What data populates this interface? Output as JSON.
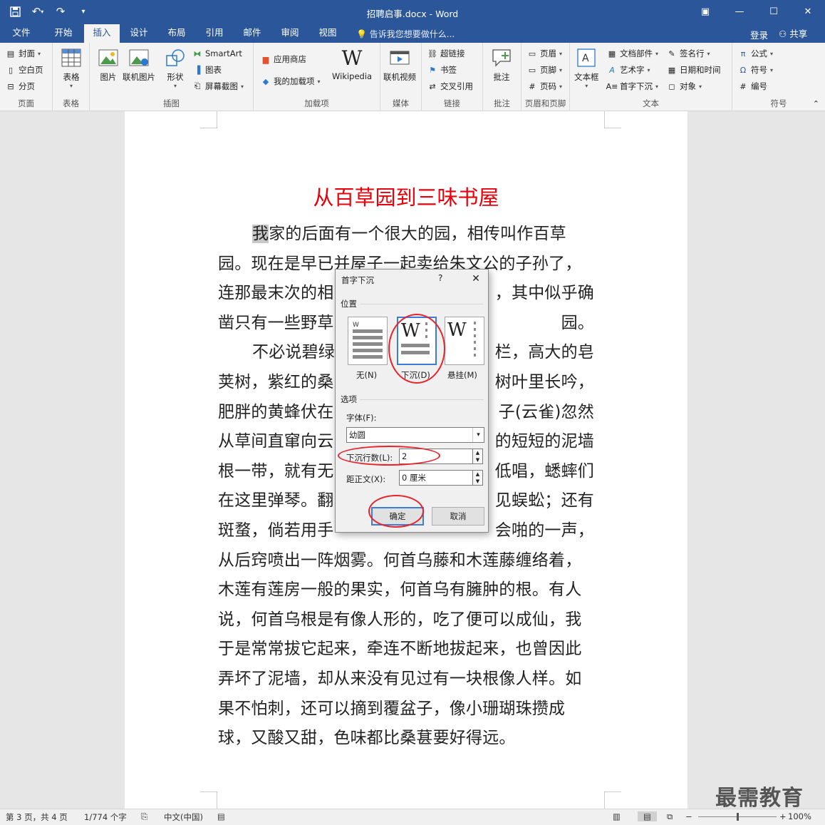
{
  "window": {
    "title": "招聘启事.docx - Word",
    "qat": [
      "save-icon",
      "undo-icon",
      "redo-icon",
      "customize-icon"
    ]
  },
  "tabs": [
    {
      "label": "文件"
    },
    {
      "label": "开始"
    },
    {
      "label": "插入"
    },
    {
      "label": "设计"
    },
    {
      "label": "布局"
    },
    {
      "label": "引用"
    },
    {
      "label": "邮件"
    },
    {
      "label": "审阅"
    },
    {
      "label": "视图"
    }
  ],
  "active_tab": "插入",
  "tell_me": "告诉我您想要做什么...",
  "account": {
    "login": "登录",
    "share": "共享"
  },
  "ribbon": {
    "groups": [
      "页面",
      "表格",
      "插图",
      "加载项",
      "媒体",
      "链接",
      "批注",
      "页眉和页脚",
      "文本",
      "符号"
    ],
    "page": {
      "cover": "封面",
      "blank": "空白页",
      "break": "分页"
    },
    "table": {
      "table": "表格"
    },
    "illustrations": {
      "picture": "图片",
      "online_picture": "联机图片",
      "shapes": "形状",
      "smartart": "SmartArt",
      "chart": "图表",
      "screenshot": "屏幕截图"
    },
    "addins": {
      "store": "应用商店",
      "my_addins": "我的加载项",
      "wikipedia": "Wikipedia"
    },
    "media": {
      "online_video": "联机视频"
    },
    "links": {
      "hyperlink": "超链接",
      "bookmark": "书签",
      "crossref": "交叉引用"
    },
    "comments": {
      "comment": "批注"
    },
    "header_footer": {
      "header": "页眉",
      "footer": "页脚",
      "page_number": "页码"
    },
    "text": {
      "textbox": "文本框",
      "quick_parts": "文档部件",
      "wordart": "艺术字",
      "dropcap": "首字下沉",
      "signature": "签名行",
      "datetime": "日期和时间",
      "object": "对象"
    },
    "symbols": {
      "equation": "公式",
      "symbol": "符号",
      "number": "编号"
    }
  },
  "document": {
    "title": "从百草园到三味书屋",
    "lines": [
      {
        "pre": "",
        "hl": "我",
        "text": "家的后面有一个很大的园，相传叫作百草"
      },
      {
        "pre": "",
        "hl": "",
        "text": "园。现在是早已并屋子一起卖给朱文公的子孙了，"
      },
      {
        "pre": "",
        "hl": "",
        "text": "连那最末次的相"
      },
      {
        "pre": "",
        "hl": "",
        "text": "凿只有一些野草"
      },
      {
        "pre": "",
        "hl": "",
        "text": "不必说碧绿"
      },
      {
        "pre": "",
        "hl": "",
        "text": "荚树，紫红的桑"
      },
      {
        "pre": "",
        "hl": "",
        "text": "肥胖的黄蜂伏在"
      },
      {
        "pre": "",
        "hl": "",
        "text": "从草间直窜向云"
      },
      {
        "pre": "",
        "hl": "",
        "text": "根一带，就有无"
      },
      {
        "pre": "",
        "hl": "",
        "text": "在这里弹琴。翻"
      },
      {
        "pre": "",
        "hl": "",
        "text": "斑蝥，倘若用手"
      },
      {
        "pre": "",
        "hl": "",
        "text": "从后窍喷出一阵烟雾。何首乌藤和木莲藤缠络着，"
      },
      {
        "pre": "",
        "hl": "",
        "text": "木莲有莲房一般的果实，何首乌有臃肿的根。有人"
      },
      {
        "pre": "",
        "hl": "",
        "text": "说，何首乌根是有像人形的，吃了便可以成仙，我"
      },
      {
        "pre": "",
        "hl": "",
        "text": "于是常常拔它起来，牵连不断地拔起来，也曾因此"
      },
      {
        "pre": "",
        "hl": "",
        "text": "弄坏了泥墙，却从来没有见过有一块根像人样。如"
      },
      {
        "pre": "",
        "hl": "",
        "text": "果不怕刺，还可以摘到覆盆子，像小珊瑚珠攒成"
      },
      {
        "pre": "",
        "hl": "",
        "text": "球，又酸又甜，色味都比桑葚要好得远。"
      }
    ],
    "right_fragments": [
      {
        "line": 2,
        "text": "，其中似乎确"
      },
      {
        "line": 3,
        "text": "园。"
      },
      {
        "line": 4,
        "text": "栏，高大的皂"
      },
      {
        "line": 5,
        "text": "树叶里长吟，"
      },
      {
        "line": 6,
        "text": "子(云雀)忽然"
      },
      {
        "line": 7,
        "text": "的短短的泥墙"
      },
      {
        "line": 8,
        "text": "低唱，蟋蟀们"
      },
      {
        "line": 9,
        "text": "见蜈蚣；还有"
      },
      {
        "line": 10,
        "text": "会啪的一声，"
      }
    ]
  },
  "dialog": {
    "title": "首字下沉",
    "help": "?",
    "position_label": "位置",
    "options": [
      {
        "label": "无(N)",
        "selected": false
      },
      {
        "label": "下沉(D)",
        "selected": true
      },
      {
        "label": "悬挂(M)",
        "selected": false
      }
    ],
    "options_label": "选项",
    "font_label": "字体(F):",
    "font_value": "幼圆",
    "lines_label": "下沉行数(L):",
    "lines_value": "2",
    "distance_label": "距正文(X):",
    "distance_value": "0 厘米",
    "ok": "确定",
    "cancel": "取消"
  },
  "status": {
    "page": "第 3 页，共 4 页",
    "words": "1/774 个字",
    "language": "中文(中国)",
    "zoom": "100%"
  },
  "watermark": "最需教育",
  "colors": {
    "accent": "#2b579a",
    "title_red": "#e8000b",
    "annotation_red": "#e8232a"
  }
}
